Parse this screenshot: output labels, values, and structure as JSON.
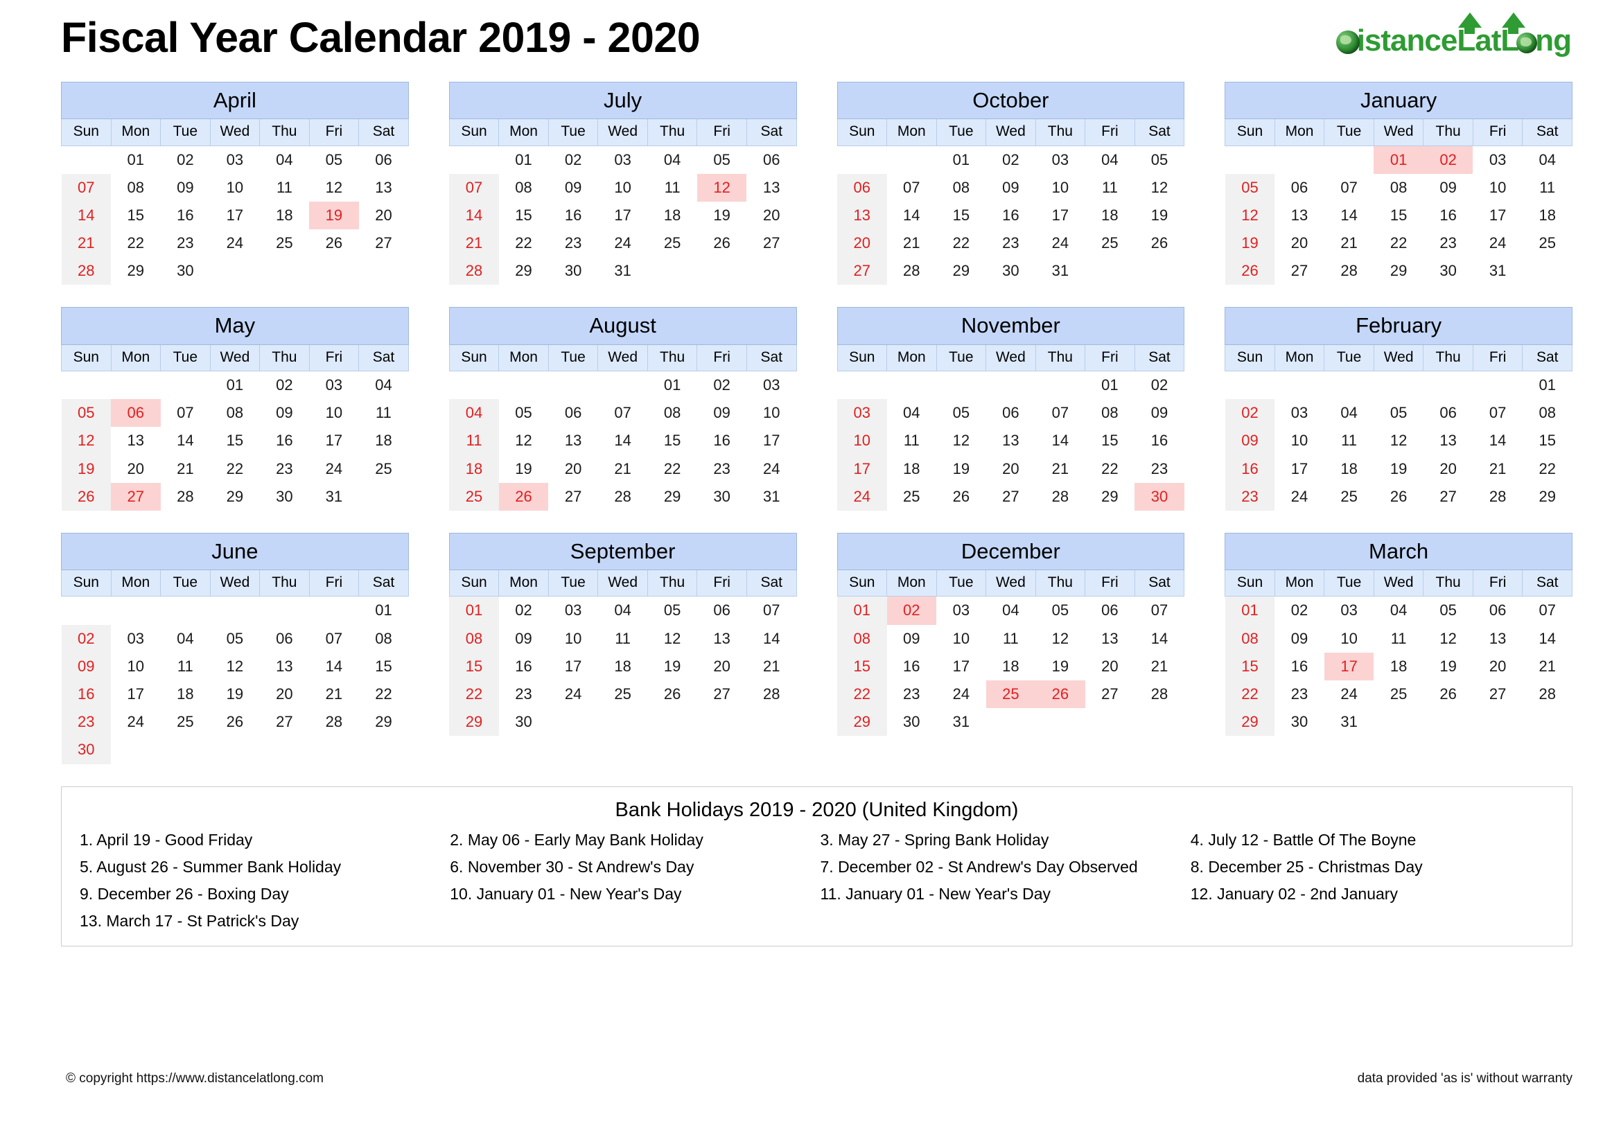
{
  "header": {
    "title": "Fiscal Year Calendar 2019 - 2020",
    "logo_text_parts": [
      "D",
      "istance",
      "L",
      "at",
      "L",
      "",
      "ng"
    ],
    "logo_full_text": "DistanceLatLong"
  },
  "colors": {
    "month_header_bg": "#c4d7f8",
    "weekday_header_bg": "#ddeafc",
    "sunday_bg": "#f1f1f1",
    "holiday_bg": "#fbd3d3",
    "holiday_text": "#e02020",
    "logo_green": "#2e9b33"
  },
  "weekdays": [
    "Sun",
    "Mon",
    "Tue",
    "Wed",
    "Thu",
    "Fri",
    "Sat"
  ],
  "months": [
    {
      "name": "April",
      "weeks": [
        [
          "",
          "01",
          "02",
          "03",
          "04",
          "05",
          "06"
        ],
        [
          "07",
          "08",
          "09",
          "10",
          "11",
          "12",
          "13"
        ],
        [
          "14",
          "15",
          "16",
          "17",
          "18",
          "19",
          "20"
        ],
        [
          "21",
          "22",
          "23",
          "24",
          "25",
          "26",
          "27"
        ],
        [
          "28",
          "29",
          "30",
          "",
          "",
          "",
          ""
        ]
      ],
      "holidays": [
        "19"
      ]
    },
    {
      "name": "July",
      "weeks": [
        [
          "",
          "01",
          "02",
          "03",
          "04",
          "05",
          "06"
        ],
        [
          "07",
          "08",
          "09",
          "10",
          "11",
          "12",
          "13"
        ],
        [
          "14",
          "15",
          "16",
          "17",
          "18",
          "19",
          "20"
        ],
        [
          "21",
          "22",
          "23",
          "24",
          "25",
          "26",
          "27"
        ],
        [
          "28",
          "29",
          "30",
          "31",
          "",
          "",
          ""
        ]
      ],
      "holidays": [
        "12"
      ]
    },
    {
      "name": "October",
      "weeks": [
        [
          "",
          "",
          "01",
          "02",
          "03",
          "04",
          "05"
        ],
        [
          "06",
          "07",
          "08",
          "09",
          "10",
          "11",
          "12"
        ],
        [
          "13",
          "14",
          "15",
          "16",
          "17",
          "18",
          "19"
        ],
        [
          "20",
          "21",
          "22",
          "23",
          "24",
          "25",
          "26"
        ],
        [
          "27",
          "28",
          "29",
          "30",
          "31",
          "",
          ""
        ]
      ],
      "holidays": []
    },
    {
      "name": "January",
      "weeks": [
        [
          "",
          "",
          "",
          "01",
          "02",
          "03",
          "04"
        ],
        [
          "05",
          "06",
          "07",
          "08",
          "09",
          "10",
          "11"
        ],
        [
          "12",
          "13",
          "14",
          "15",
          "16",
          "17",
          "18"
        ],
        [
          "19",
          "20",
          "21",
          "22",
          "23",
          "24",
          "25"
        ],
        [
          "26",
          "27",
          "28",
          "29",
          "30",
          "31",
          ""
        ]
      ],
      "holidays": [
        "01",
        "02"
      ]
    },
    {
      "name": "May",
      "weeks": [
        [
          "",
          "",
          "",
          "01",
          "02",
          "03",
          "04"
        ],
        [
          "05",
          "06",
          "07",
          "08",
          "09",
          "10",
          "11"
        ],
        [
          "12",
          "13",
          "14",
          "15",
          "16",
          "17",
          "18"
        ],
        [
          "19",
          "20",
          "21",
          "22",
          "23",
          "24",
          "25"
        ],
        [
          "26",
          "27",
          "28",
          "29",
          "30",
          "31",
          ""
        ]
      ],
      "holidays": [
        "06",
        "27"
      ]
    },
    {
      "name": "August",
      "weeks": [
        [
          "",
          "",
          "",
          "",
          "01",
          "02",
          "03"
        ],
        [
          "04",
          "05",
          "06",
          "07",
          "08",
          "09",
          "10"
        ],
        [
          "11",
          "12",
          "13",
          "14",
          "15",
          "16",
          "17"
        ],
        [
          "18",
          "19",
          "20",
          "21",
          "22",
          "23",
          "24"
        ],
        [
          "25",
          "26",
          "27",
          "28",
          "29",
          "30",
          "31"
        ]
      ],
      "holidays": [
        "26"
      ]
    },
    {
      "name": "November",
      "weeks": [
        [
          "",
          "",
          "",
          "",
          "",
          "01",
          "02"
        ],
        [
          "03",
          "04",
          "05",
          "06",
          "07",
          "08",
          "09"
        ],
        [
          "10",
          "11",
          "12",
          "13",
          "14",
          "15",
          "16"
        ],
        [
          "17",
          "18",
          "19",
          "20",
          "21",
          "22",
          "23"
        ],
        [
          "24",
          "25",
          "26",
          "27",
          "28",
          "29",
          "30"
        ]
      ],
      "holidays": [
        "30"
      ]
    },
    {
      "name": "February",
      "weeks": [
        [
          "",
          "",
          "",
          "",
          "",
          "",
          "01"
        ],
        [
          "02",
          "03",
          "04",
          "05",
          "06",
          "07",
          "08"
        ],
        [
          "09",
          "10",
          "11",
          "12",
          "13",
          "14",
          "15"
        ],
        [
          "16",
          "17",
          "18",
          "19",
          "20",
          "21",
          "22"
        ],
        [
          "23",
          "24",
          "25",
          "26",
          "27",
          "28",
          "29"
        ]
      ],
      "holidays": []
    },
    {
      "name": "June",
      "weeks": [
        [
          "",
          "",
          "",
          "",
          "",
          "",
          "01"
        ],
        [
          "02",
          "03",
          "04",
          "05",
          "06",
          "07",
          "08"
        ],
        [
          "09",
          "10",
          "11",
          "12",
          "13",
          "14",
          "15"
        ],
        [
          "16",
          "17",
          "18",
          "19",
          "20",
          "21",
          "22"
        ],
        [
          "23",
          "24",
          "25",
          "26",
          "27",
          "28",
          "29"
        ],
        [
          "30",
          "",
          "",
          "",
          "",
          "",
          ""
        ]
      ],
      "holidays": []
    },
    {
      "name": "September",
      "weeks": [
        [
          "01",
          "02",
          "03",
          "04",
          "05",
          "06",
          "07"
        ],
        [
          "08",
          "09",
          "10",
          "11",
          "12",
          "13",
          "14"
        ],
        [
          "15",
          "16",
          "17",
          "18",
          "19",
          "20",
          "21"
        ],
        [
          "22",
          "23",
          "24",
          "25",
          "26",
          "27",
          "28"
        ],
        [
          "29",
          "30",
          "",
          "",
          "",
          "",
          ""
        ]
      ],
      "holidays": []
    },
    {
      "name": "December",
      "weeks": [
        [
          "01",
          "02",
          "03",
          "04",
          "05",
          "06",
          "07"
        ],
        [
          "08",
          "09",
          "10",
          "11",
          "12",
          "13",
          "14"
        ],
        [
          "15",
          "16",
          "17",
          "18",
          "19",
          "20",
          "21"
        ],
        [
          "22",
          "23",
          "24",
          "25",
          "26",
          "27",
          "28"
        ],
        [
          "29",
          "30",
          "31",
          "",
          "",
          "",
          ""
        ]
      ],
      "holidays": [
        "02",
        "25",
        "26"
      ]
    },
    {
      "name": "March",
      "weeks": [
        [
          "01",
          "02",
          "03",
          "04",
          "05",
          "06",
          "07"
        ],
        [
          "08",
          "09",
          "10",
          "11",
          "12",
          "13",
          "14"
        ],
        [
          "15",
          "16",
          "17",
          "18",
          "19",
          "20",
          "21"
        ],
        [
          "22",
          "23",
          "24",
          "25",
          "26",
          "27",
          "28"
        ],
        [
          "29",
          "30",
          "31",
          "",
          "",
          "",
          ""
        ]
      ],
      "holidays": [
        "17"
      ]
    }
  ],
  "holidays_panel": {
    "title": "Bank Holidays 2019 - 2020 (United Kingdom)",
    "items": [
      "1. April 19 - Good Friday",
      "2. May 06 - Early May Bank Holiday",
      "3. May 27 - Spring Bank Holiday",
      "4. July 12 - Battle Of The Boyne",
      "5. August 26 - Summer Bank Holiday",
      "6. November 30 - St Andrew's Day",
      "7. December 02 - St Andrew's Day Observed",
      "8. December 25 - Christmas Day",
      "9. December 26 - Boxing Day",
      "10. January 01 - New Year's Day",
      "11. January 01 - New Year's Day",
      "12. January 02 - 2nd January",
      "13. March 17 - St Patrick's Day"
    ]
  },
  "footer": {
    "copyright": "© copyright https://www.distancelatlong.com",
    "disclaimer": "data provided 'as is' without warranty"
  }
}
